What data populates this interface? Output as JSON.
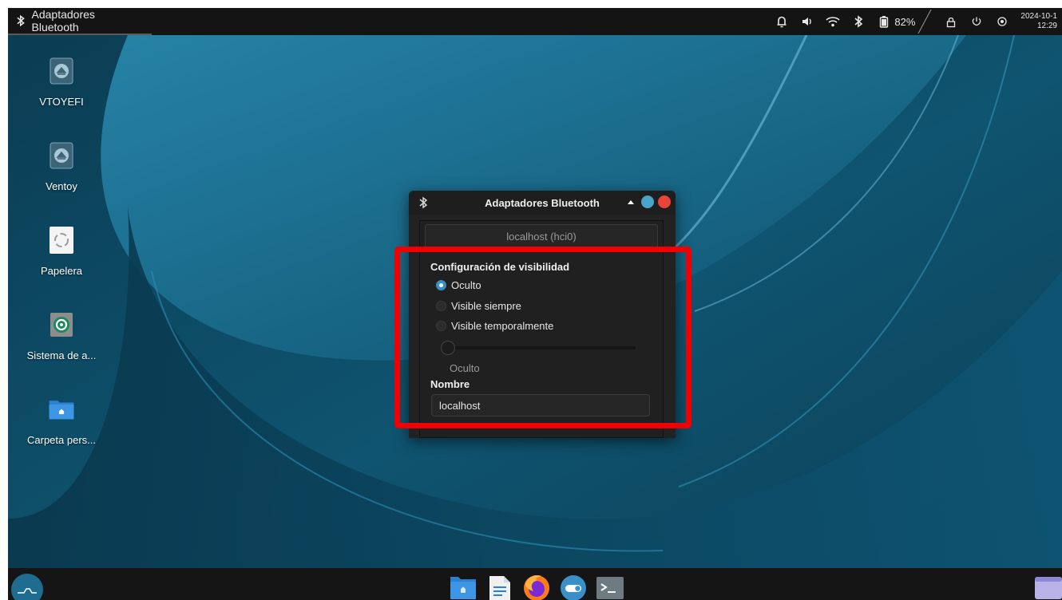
{
  "top_panel": {
    "task_title": "Adaptadores Bluetooth",
    "battery_percent": "82%",
    "date": "2024-10-1",
    "time": "12:29",
    "icons": [
      "bluetooth-icon",
      "bell-icon",
      "volume-icon",
      "wifi-icon",
      "bluetooth-icon",
      "battery-icon",
      "lock-icon",
      "power-icon",
      "settings-icon"
    ]
  },
  "desktop": {
    "icons": [
      {
        "label": "VTOYEFI",
        "icon": "drive-eject-icon"
      },
      {
        "label": "Ventoy",
        "icon": "drive-eject-icon"
      },
      {
        "label": "Papelera",
        "icon": "trash-icon"
      },
      {
        "label": "Sistema de a...",
        "icon": "software-center-icon"
      },
      {
        "label": "Carpeta pers...",
        "icon": "home-folder-icon"
      }
    ]
  },
  "dialog": {
    "title": "Adaptadores Bluetooth",
    "adapter_tab": "localhost (hci0)",
    "visibility_section": "Configuración de visibilidad",
    "options": [
      {
        "label": "Oculto",
        "checked": true
      },
      {
        "label": "Visible siempre",
        "checked": false
      },
      {
        "label": "Visible temporalmente",
        "checked": false
      }
    ],
    "slider_value_label": "Oculto",
    "slider_level": 0,
    "name_section": "Nombre",
    "name_value": "localhost"
  },
  "colors": {
    "highlight": "#f00000",
    "radio_checked": "#3b8fc9",
    "maximize_button": "#4aa3c8",
    "close_button": "#e8443a"
  },
  "dock": {
    "items": [
      "launcher-icon",
      "file-manager-icon",
      "text-editor-icon",
      "firefox-icon",
      "settings-toggle-icon",
      "terminal-icon",
      "workspace-icon"
    ]
  }
}
